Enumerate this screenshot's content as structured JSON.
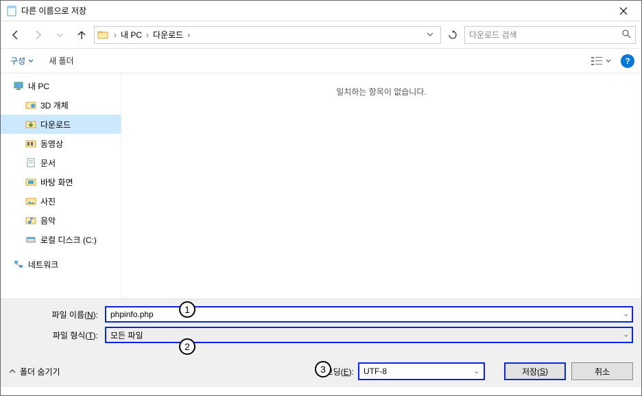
{
  "title": "다른 이름으로 저장",
  "breadcrumb": {
    "seg1": "내 PC",
    "seg2": "다운로드"
  },
  "search_placeholder": "다운로드 검색",
  "toolbar": {
    "organize": "구성",
    "newfolder": "새 폴더"
  },
  "tree": {
    "mypc": "내 PC",
    "objects3d": "3D 개체",
    "downloads": "다운로드",
    "videos": "동영상",
    "documents": "문서",
    "desktop": "바탕 화면",
    "pictures": "사진",
    "music": "음악",
    "localdisk": "로컬 디스크 (C:)",
    "network": "네트워크"
  },
  "content_msg": "일치하는 항목이 없습니다.",
  "filename_label_pre": "파일 이름(",
  "filename_label_key": "N",
  "filename_label_post": "):",
  "filename_value": "phpinfo.php",
  "filetype_label_pre": "파일 형식(",
  "filetype_label_key": "T",
  "filetype_label_post": "):",
  "filetype_value": "모든 파일",
  "hidefolders": "폴더 숨기기",
  "encoding_label_pre": "인코딩(",
  "encoding_label_key": "E",
  "encoding_label_post": "):",
  "encoding_value": "UTF-8",
  "save_btn_pre": "저장(",
  "save_btn_key": "S",
  "save_btn_post": ")",
  "cancel_btn": "취소",
  "callouts": {
    "c1": "1",
    "c2": "2",
    "c3": "3"
  }
}
